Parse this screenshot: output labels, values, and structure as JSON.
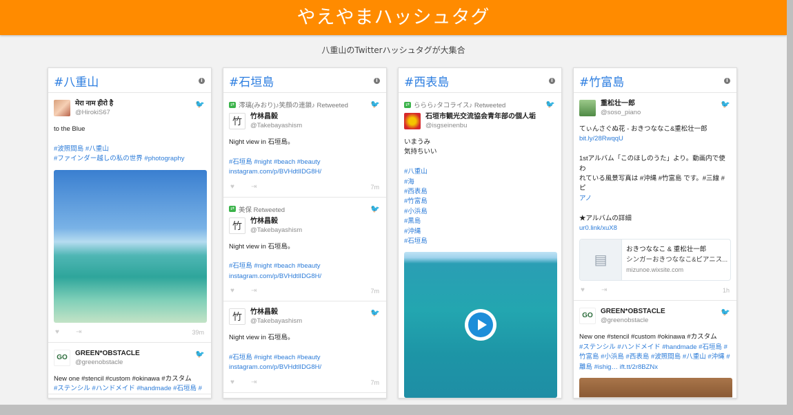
{
  "header": {
    "title": "やえやまハッシュタグ",
    "subtitle": "八重山のTwitterハッシュタグが大集合"
  },
  "colors": {
    "accent": "#ff8b00",
    "link": "#2b7bd8",
    "retweet": "#3bb34a"
  },
  "icons": {
    "info": "info-icon",
    "bird": "twitter-bird-icon",
    "like": "heart-icon",
    "share": "share-icon",
    "retweet": "retweet-icon",
    "play": "play-icon",
    "article": "article-icon"
  },
  "columns": [
    {
      "title": "#八重山",
      "tweets": [
        {
          "name": "मेरा नाम हीरो है",
          "handle": "@HirokiS67",
          "lines": [
            "to the Blue",
            "",
            "#波照間島 #八重山",
            "#ファインダー越しの私の世界 #photography"
          ],
          "time": "39m"
        },
        {
          "name": "GREEN*OBSTACLE",
          "handle": "@greenobstacle",
          "lines": [
            "New one  #stencil #custom  #okinawa  #カスタム",
            "#ステンシル #ハンドメイド #handmade #石垣島 #"
          ]
        }
      ]
    },
    {
      "title": "#石垣島",
      "tweets": [
        {
          "retweeted_by": "澪璃(みおり)♪笑顔の連鎖♪ Retweeted",
          "name": "竹林昌毅",
          "handle": "@Takebayashism",
          "lines": [
            "Night view in 石垣島。",
            "",
            "#石垣島 #night #beach #beauty",
            "instagram.com/p/BVHdtlIDG8H/"
          ],
          "time": "7m"
        },
        {
          "retweeted_by": "美保 Retweeted",
          "name": "竹林昌毅",
          "handle": "@Takebayashism",
          "lines": [
            "Night view in 石垣島。",
            "",
            "#石垣島 #night #beach #beauty",
            "instagram.com/p/BVHdtlIDG8H/"
          ],
          "time": "7m"
        },
        {
          "name": "竹林昌毅",
          "handle": "@Takebayashism",
          "lines": [
            "Night view in 石垣島。",
            "",
            "#石垣島 #night #beach #beauty",
            "instagram.com/p/BVHdtlIDG8H/"
          ],
          "time": "7m"
        }
      ]
    },
    {
      "title": "#西表島",
      "tweets": [
        {
          "retweeted_by": "ららら♪タコライス♪ Retweeted",
          "name": "石垣市観光交流協会青年部の個人垢",
          "handle": "@isgseinenbu",
          "lines": [
            "いまうみ",
            "気持ちいい",
            "",
            "#八重山",
            "#海",
            "#西表島",
            "#竹富島",
            "#小浜島",
            "#黒島",
            "#沖縄",
            "#石垣島"
          ]
        }
      ]
    },
    {
      "title": "#竹富島",
      "tweets": [
        {
          "name": "重松壮一郎",
          "handle": "@soso_piano",
          "lines": [
            "てぃんさぐぬ花 - おきつななこ&重松壮一郎",
            "bit.ly/28RwqqU",
            "",
            "1stアルバム「このほしのうた」より。動画内で使わ",
            "れている風景写真は #沖縄 #竹富島 です。#三線 #ピ",
            "アノ",
            "",
            "★アルバムの詳細",
            "ur0.link/xuX8"
          ],
          "card": {
            "title": "おきつななこ & 重松壮一郎",
            "desc": "シンガーおきつななこ&ピアニス...",
            "url": "mizunoe.wixsite.com"
          },
          "time": "1h"
        },
        {
          "name": "GREEN*OBSTACLE",
          "handle": "@greenobstacle",
          "lines": [
            "New one  #stencil #custom  #okinawa  #カスタム",
            "#ステンシル #ハンドメイド #handmade #石垣島 #",
            "竹富島 #小浜島 #西表島 #波照間島 #八重山 #沖縄 #",
            "離島  #ishig…  ift.tt/2r8BZNx"
          ]
        }
      ]
    }
  ]
}
